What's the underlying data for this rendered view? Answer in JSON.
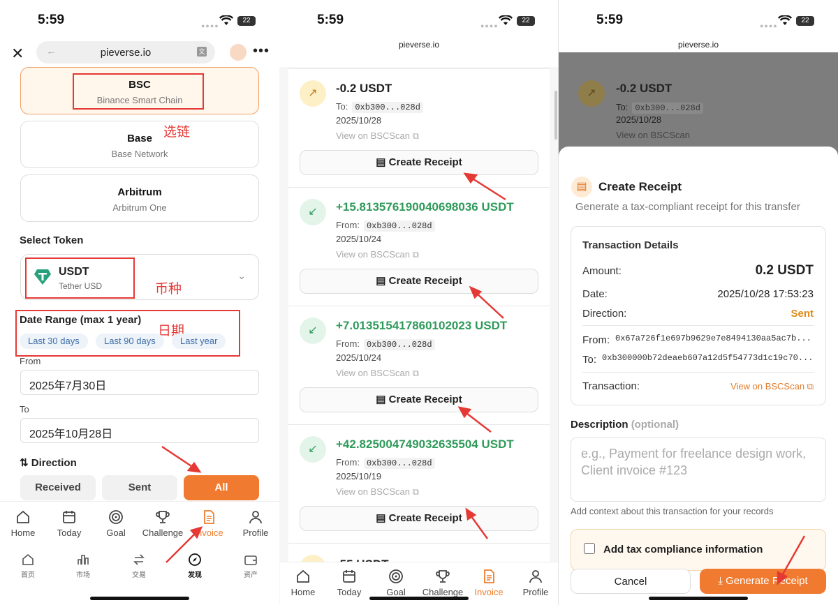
{
  "status": {
    "time": "5:59",
    "battery": "22"
  },
  "panel1": {
    "url": "pieverse.io",
    "chains": [
      {
        "name": "BSC",
        "sub": "Binance Smart Chain"
      },
      {
        "name": "Base",
        "sub": "Base Network"
      },
      {
        "name": "Arbitrum",
        "sub": "Arbitrum One"
      }
    ],
    "note_chain": "选链",
    "select_token_title": "Select Token",
    "token": {
      "name": "USDT",
      "sub": "Tether USD"
    },
    "note_token": "币种",
    "date_range_title": "Date Range (max 1 year)",
    "note_date": "日期",
    "presets": [
      "Last 30 days",
      "Last 90 days",
      "Last year"
    ],
    "from_label": "From",
    "from_value": "2025年7月30日",
    "to_label": "To",
    "to_value": "2025年10月28日",
    "direction_title": "Direction",
    "directions": [
      "Received",
      "Sent",
      "All"
    ],
    "tabs": [
      "Home",
      "Today",
      "Goal",
      "Challenge",
      "Invoice",
      "Profile"
    ],
    "subtabs": [
      "首页",
      "市场",
      "交易",
      "发现",
      "资产"
    ]
  },
  "panel2": {
    "url": "pieverse.io",
    "transactions": [
      {
        "amount": "-0.2 USDT",
        "label": "To:",
        "addr": "0xb300...028d",
        "date": "2025/10/28",
        "link": "View on BSCScan",
        "button": "Create Receipt"
      },
      {
        "amount": "+15.813576190040698036 USDT",
        "label": "From:",
        "addr": "0xb300...028d",
        "date": "2025/10/24",
        "link": "View on BSCScan",
        "button": "Create Receipt"
      },
      {
        "amount": "+7.013515417860102023 USDT",
        "label": "From:",
        "addr": "0xb300...028d",
        "date": "2025/10/24",
        "link": "View on BSCScan",
        "button": "Create Receipt"
      },
      {
        "amount": "+42.825004749032635504 USDT",
        "label": "From:",
        "addr": "0xb300...028d",
        "date": "2025/10/19",
        "link": "View on BSCScan",
        "button": "Create Receipt"
      }
    ],
    "partial_amount": "-55 USDT",
    "tabs": [
      "Home",
      "Today",
      "Goal",
      "Challenge",
      "Invoice",
      "Profile"
    ]
  },
  "panel3": {
    "url": "pieverse.io",
    "bg_tx": {
      "amount": "-0.2 USDT",
      "label": "To:",
      "addr": "0xb300...028d",
      "date": "2025/10/28",
      "link": "View on BSCScan"
    },
    "title": "Create Receipt",
    "subtitle": "Generate a tax-compliant receipt for this transfer",
    "details_title": "Transaction Details",
    "amount_label": "Amount:",
    "amount_value": "0.2 USDT",
    "date_label": "Date:",
    "date_value": "2025/10/28 17:53:23",
    "direction_label": "Direction:",
    "direction_value": "Sent",
    "from_label": "From:",
    "from_value": "0x67a726f1e697b9629e7e8494130aa5ac7b...",
    "to_label": "To:",
    "to_value": "0xb300000b72deaeb607a12d5f54773d1c19c70...",
    "transaction_label": "Transaction:",
    "transaction_link": "View on BSCScan",
    "description_title": "Description",
    "description_optional": "(optional)",
    "description_placeholder": "e.g., Payment for freelance design work, Client invoice #123",
    "description_hint": "Add context about this transaction for your records",
    "tax_label": "Add tax compliance information",
    "cancel": "Cancel",
    "generate": "Generate Receipt"
  },
  "colors": {
    "accent": "#f07b30",
    "positive": "#2f9a5a",
    "annotation": "#e53935"
  }
}
